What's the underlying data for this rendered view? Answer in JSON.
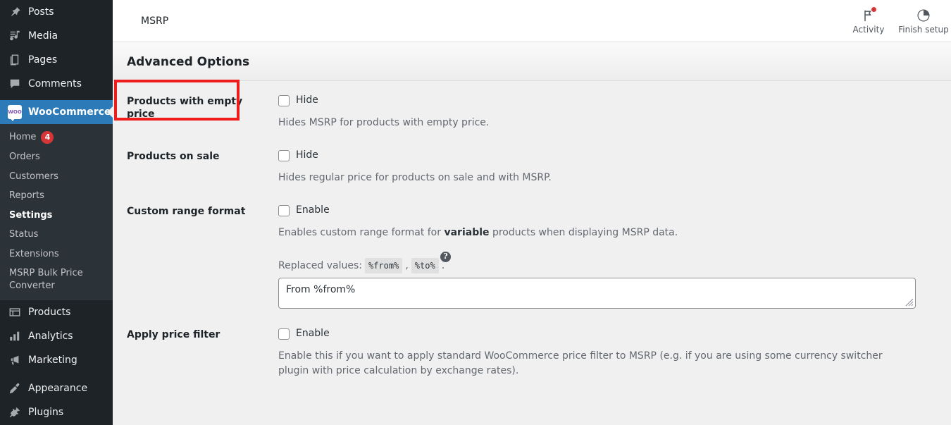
{
  "sidebar": {
    "top_items": [
      {
        "label": "Posts",
        "icon": "pin-icon"
      },
      {
        "label": "Media",
        "icon": "media-icon"
      },
      {
        "label": "Pages",
        "icon": "pages-icon"
      },
      {
        "label": "Comments",
        "icon": "comments-icon"
      }
    ],
    "active_item": {
      "label": "WooCommerce",
      "icon": "woocommerce-icon",
      "badge": "WOO"
    },
    "submenu": [
      {
        "label": "Home",
        "count": "4",
        "current": false
      },
      {
        "label": "Orders",
        "count": "",
        "current": false
      },
      {
        "label": "Customers",
        "count": "",
        "current": false
      },
      {
        "label": "Reports",
        "count": "",
        "current": false
      },
      {
        "label": "Settings",
        "count": "",
        "current": true
      },
      {
        "label": "Status",
        "count": "",
        "current": false
      },
      {
        "label": "Extensions",
        "count": "",
        "current": false
      },
      {
        "label": "MSRP Bulk Price Converter",
        "count": "",
        "current": false
      }
    ],
    "bottom_items": [
      {
        "label": "Products",
        "icon": "products-icon"
      },
      {
        "label": "Analytics",
        "icon": "analytics-icon"
      },
      {
        "label": "Marketing",
        "icon": "marketing-icon"
      },
      {
        "label": "Appearance",
        "icon": "appearance-icon"
      },
      {
        "label": "Plugins",
        "icon": "plugins-icon"
      }
    ],
    "colors": {
      "bg": "#1d2327",
      "submenu_bg": "#2c3338",
      "active_bg": "#2c7ab8",
      "badge_bg": "#d63638"
    }
  },
  "wc_bar": {
    "title": "MSRP",
    "activity_label": "Activity",
    "finish_setup_label": "Finish setup"
  },
  "settings": {
    "tab_title": "Advanced Options",
    "highlight_color": "#ee1c1c",
    "rows": [
      {
        "label": "Products with empty price",
        "checkbox_label": "Hide",
        "checked": false,
        "description": "Hides MSRP for products with empty price."
      },
      {
        "label": "Products on sale",
        "checkbox_label": "Hide",
        "checked": false,
        "description": "Hides regular price for products on sale and with MSRP."
      },
      {
        "label": "Custom range format",
        "checkbox_label": "Enable",
        "checked": false,
        "description_pre": "Enables custom range format for ",
        "description_bold": "variable",
        "description_post": " products when displaying MSRP data."
      },
      {
        "label": "Apply price filter",
        "checkbox_label": "Enable",
        "checked": false,
        "description": "Enable this if you want to apply standard WooCommerce price filter to MSRP (e.g. if you are using some currency switcher plugin with price calculation by exchange rates)."
      }
    ],
    "range_format": {
      "help_icon": "help-icon",
      "replaced_values_label": "Replaced values:",
      "token_from": "%from%",
      "token_separator": ",",
      "token_to": "%to%",
      "token_end": ".",
      "textarea_value": "From %from%",
      "textarea_placeholder": ""
    }
  }
}
